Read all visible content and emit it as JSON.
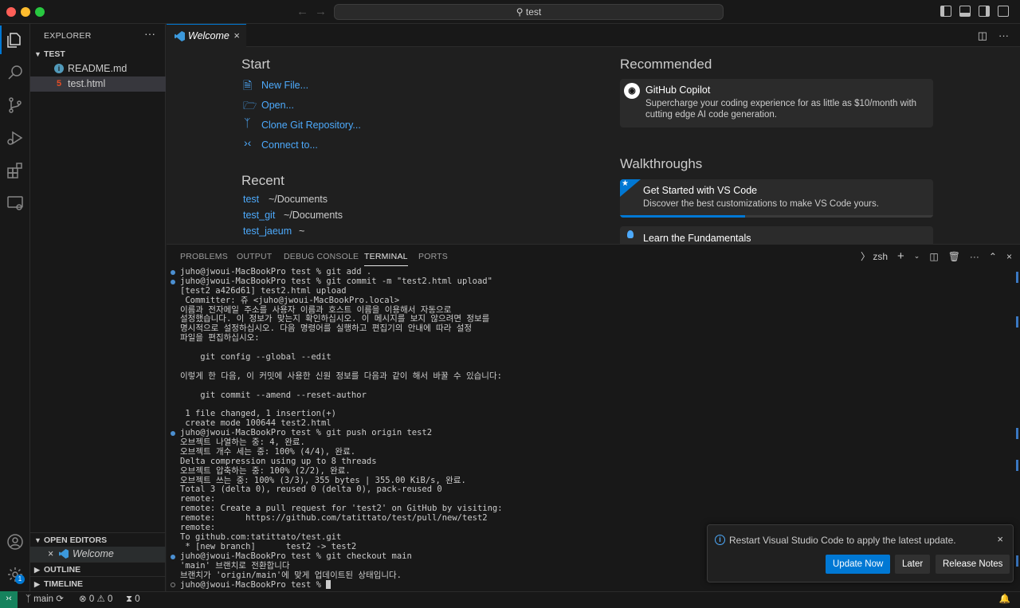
{
  "titlebar": {
    "search_text": "test"
  },
  "sidebar": {
    "title": "EXPLORER",
    "more": "···",
    "folder": "TEST",
    "files": [
      {
        "name": "README.md",
        "icon": "info-icon",
        "color": "#519aba"
      },
      {
        "name": "test.html",
        "icon": "html5-icon",
        "color": "#e44d26"
      }
    ],
    "open_editors_label": "OPEN EDITORS",
    "open_editor_item": "Welcome",
    "outline_label": "OUTLINE",
    "timeline_label": "TIMELINE"
  },
  "editor": {
    "tab_label": "Welcome",
    "start": {
      "heading": "Start",
      "items": [
        "New File...",
        "Open...",
        "Clone Git Repository...",
        "Connect to..."
      ]
    },
    "recent": {
      "heading": "Recent",
      "items": [
        {
          "name": "test",
          "path": "~/Documents"
        },
        {
          "name": "test_git",
          "path": "~/Documents"
        },
        {
          "name": "test_jaeum",
          "path": "~"
        }
      ]
    },
    "recommended": {
      "heading": "Recommended",
      "title": "GitHub Copilot",
      "description": "Supercharge your coding experience for as little as $10/month with cutting edge AI code generation."
    },
    "walkthroughs": {
      "heading": "Walkthroughs",
      "items": [
        {
          "title": "Get Started with VS Code",
          "description": "Discover the best customizations to make VS Code yours.",
          "progress": 0.4
        },
        {
          "title": "Learn the Fundamentals"
        }
      ]
    }
  },
  "panel": {
    "tabs": [
      "PROBLEMS",
      "OUTPUT",
      "DEBUG CONSOLE",
      "TERMINAL",
      "PORTS"
    ],
    "active_tab": "TERMINAL",
    "shell": "zsh",
    "lines": [
      {
        "t": "juho@jwoui-MacBookPro test % git add .",
        "dot": "b"
      },
      {
        "t": "juho@jwoui-MacBookPro test % git commit -m \"test2.html upload\"",
        "dot": "b"
      },
      {
        "t": "[test2 a426d61] test2.html upload"
      },
      {
        "t": " Committer: 쥬 <juho@jwoui-MacBookPro.local>"
      },
      {
        "t": "이름과 전자메일 주소를 사용자 이름과 호스트 이름을 이용해서 자동으로"
      },
      {
        "t": "설정했습니다. 이 정보가 맞는지 확인하십시오. 이 메시지를 보지 않으려면 정보를"
      },
      {
        "t": "명시적으로 설정하십시오. 다음 명령어를 실행하고 편집기의 안내에 따라 설정"
      },
      {
        "t": "파일을 편집하십시오:"
      },
      {
        "t": ""
      },
      {
        "t": "    git config --global --edit"
      },
      {
        "t": ""
      },
      {
        "t": "이렇게 한 다음, 이 커밋에 사용한 신원 정보를 다음과 같이 해서 바꿀 수 있습니다:"
      },
      {
        "t": ""
      },
      {
        "t": "    git commit --amend --reset-author"
      },
      {
        "t": ""
      },
      {
        "t": " 1 file changed, 1 insertion(+)"
      },
      {
        "t": " create mode 100644 test2.html"
      },
      {
        "t": "juho@jwoui-MacBookPro test % git push origin test2",
        "dot": "b"
      },
      {
        "t": "오브젝트 나열하는 중: 4, 완료."
      },
      {
        "t": "오브젝트 개수 세는 중: 100% (4/4), 완료."
      },
      {
        "t": "Delta compression using up to 8 threads"
      },
      {
        "t": "오브젝트 압축하는 중: 100% (2/2), 완료."
      },
      {
        "t": "오브젝트 쓰는 중: 100% (3/3), 355 bytes | 355.00 KiB/s, 완료."
      },
      {
        "t": "Total 3 (delta 0), reused 0 (delta 0), pack-reused 0"
      },
      {
        "t": "remote:"
      },
      {
        "t": "remote: Create a pull request for 'test2' on GitHub by visiting:"
      },
      {
        "t": "remote:      https://github.com/tatittato/test/pull/new/test2"
      },
      {
        "t": "remote:"
      },
      {
        "t": "To github.com:tatittato/test.git"
      },
      {
        "t": " * [new branch]      test2 -> test2"
      },
      {
        "t": "juho@jwoui-MacBookPro test % git checkout main",
        "dot": "b"
      },
      {
        "t": "'main' 브랜치로 전환합니다"
      },
      {
        "t": "브랜치가 'origin/main'에 맞게 업데이트된 상태입니다."
      },
      {
        "t": "juho@jwoui-MacBookPro test % ",
        "dot": "o",
        "cursor": true
      }
    ]
  },
  "notification": {
    "message": "Restart Visual Studio Code to apply the latest update.",
    "buttons": [
      "Update Now",
      "Later",
      "Release Notes"
    ]
  },
  "statusbar": {
    "branch": "main",
    "errors": "0",
    "warnings": "0",
    "ports": "0"
  },
  "colors": {
    "accent": "#0078d4",
    "link": "#4daafc",
    "remote": "#16825d"
  }
}
